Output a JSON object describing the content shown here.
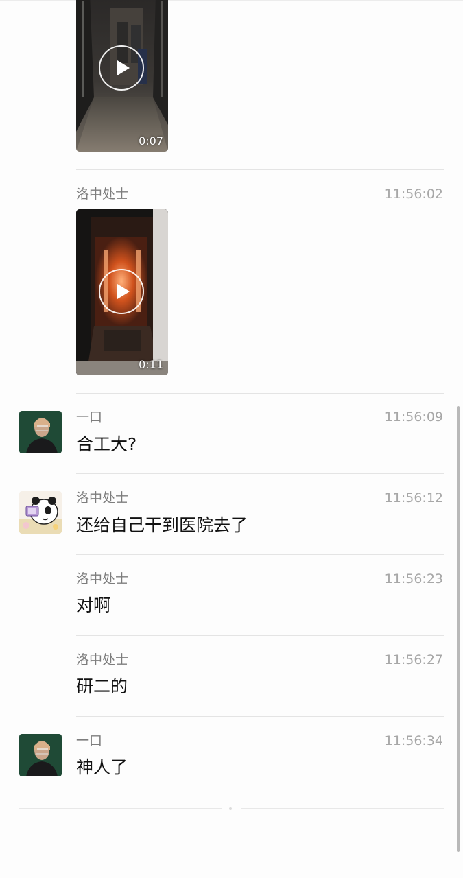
{
  "videos": [
    {
      "duration": "0:07"
    },
    {
      "duration": "0:11"
    }
  ],
  "messages": [
    {
      "sender": "洛中处士",
      "time": "11:56:02",
      "text": ""
    },
    {
      "sender": "一口",
      "time": "11:56:09",
      "text": "合工大?"
    },
    {
      "sender": "洛中处士",
      "time": "11:56:12",
      "text": "还给自己干到医院去了"
    },
    {
      "sender": "洛中处士",
      "time": "11:56:23",
      "text": "对啊"
    },
    {
      "sender": "洛中处士",
      "time": "11:56:27",
      "text": "研二的"
    },
    {
      "sender": "一口",
      "time": "11:56:34",
      "text": "神人了"
    }
  ],
  "icons": {
    "play": "play-icon",
    "avatar_yikou": "avatar-green-portrait",
    "avatar_luozhong": "avatar-cartoon-panda"
  },
  "colors": {
    "background": "#fdfdfd",
    "name_text": "#7d7d7d",
    "time_text": "#a7a7a7",
    "message_text": "#111111",
    "avatar_green": "#1f4a36"
  }
}
